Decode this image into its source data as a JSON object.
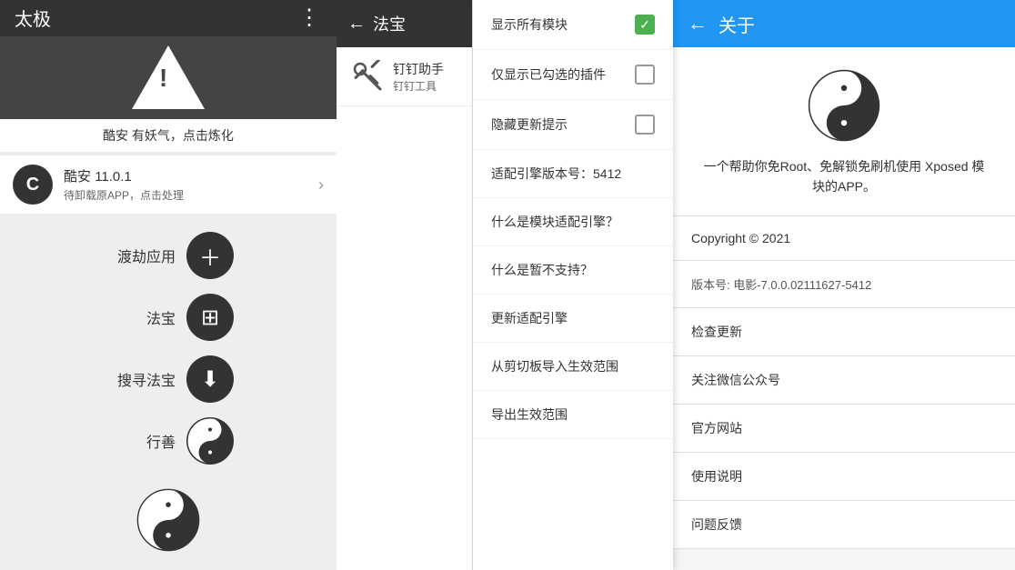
{
  "left": {
    "title": "太极",
    "warning_text": "酷安 有妖气，点击炼化",
    "app": {
      "name": "酷安",
      "version": "11.0.1",
      "status": "待卸载原APP，点击处理"
    },
    "buttons": [
      {
        "label": "渡劫应用",
        "icon": "plus"
      },
      {
        "label": "法宝",
        "icon": "grid"
      },
      {
        "label": "搜寻法宝",
        "icon": "download"
      },
      {
        "label": "行善",
        "icon": "dollar"
      }
    ]
  },
  "middle": {
    "back_label": "←",
    "title": "法宝",
    "plugin": {
      "name1": "钉钉助手",
      "name2": "钉钉工具"
    }
  },
  "dropdown": {
    "items": [
      {
        "label": "显示所有模块",
        "type": "checkbox_checked"
      },
      {
        "label": "仅显示已勾选的插件",
        "type": "checkbox_empty"
      },
      {
        "label": "隐藏更新提示",
        "type": "checkbox_empty"
      },
      {
        "label": "适配引擎版本号：5412",
        "type": "text"
      },
      {
        "label": "什么是模块适配引擎？",
        "type": "link"
      },
      {
        "label": "什么是暂不支持？",
        "type": "link"
      },
      {
        "label": "更新适配引擎",
        "type": "link"
      },
      {
        "label": "从剪切板导入生效范围",
        "type": "link"
      },
      {
        "label": "导出生效范围",
        "type": "link"
      }
    ]
  },
  "right": {
    "back_label": "←",
    "title": "关于",
    "description": "一个帮助你免Root、免解锁免刷机使用\nXposed 模块的APP。",
    "copyright": "Copyright © 2021",
    "version": "版本号: 电影-7.0.0.02111627-5412",
    "menu_items": [
      "检查更新",
      "关注微信公众号",
      "官方网站",
      "使用说明",
      "问题反馈"
    ]
  }
}
